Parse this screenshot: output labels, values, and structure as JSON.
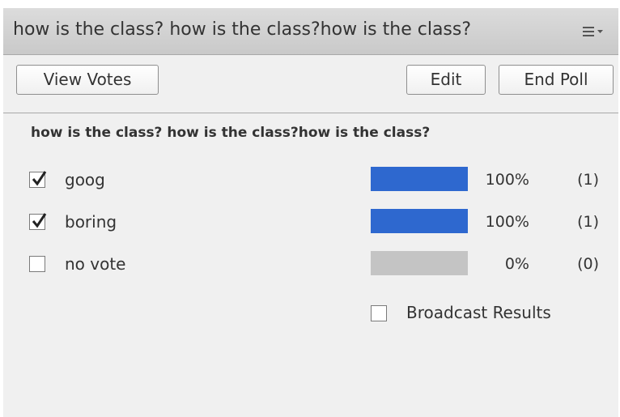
{
  "header": {
    "title": "how is the class? how is the class?how is the class?",
    "menu_icon": "menu-icon"
  },
  "toolbar": {
    "view_votes_label": "View Votes",
    "edit_label": "Edit",
    "end_poll_label": "End Poll"
  },
  "poll": {
    "question": "how is the class? how is the class?how is the class?",
    "answers": [
      {
        "label": "goog",
        "checked": true,
        "percent": "100%",
        "count": "(1)",
        "fraction": 1.0
      },
      {
        "label": "boring",
        "checked": true,
        "percent": "100%",
        "count": "(1)",
        "fraction": 1.0
      },
      {
        "label": "no vote",
        "checked": false,
        "percent": "0%",
        "count": "(0)",
        "fraction": 0.0
      }
    ],
    "broadcast_label": "Broadcast Results",
    "broadcast_checked": false
  },
  "colors": {
    "bar_fill": "#2e68cf",
    "bar_empty": "#c4c4c4",
    "panel_bg": "#f0f0f0"
  }
}
